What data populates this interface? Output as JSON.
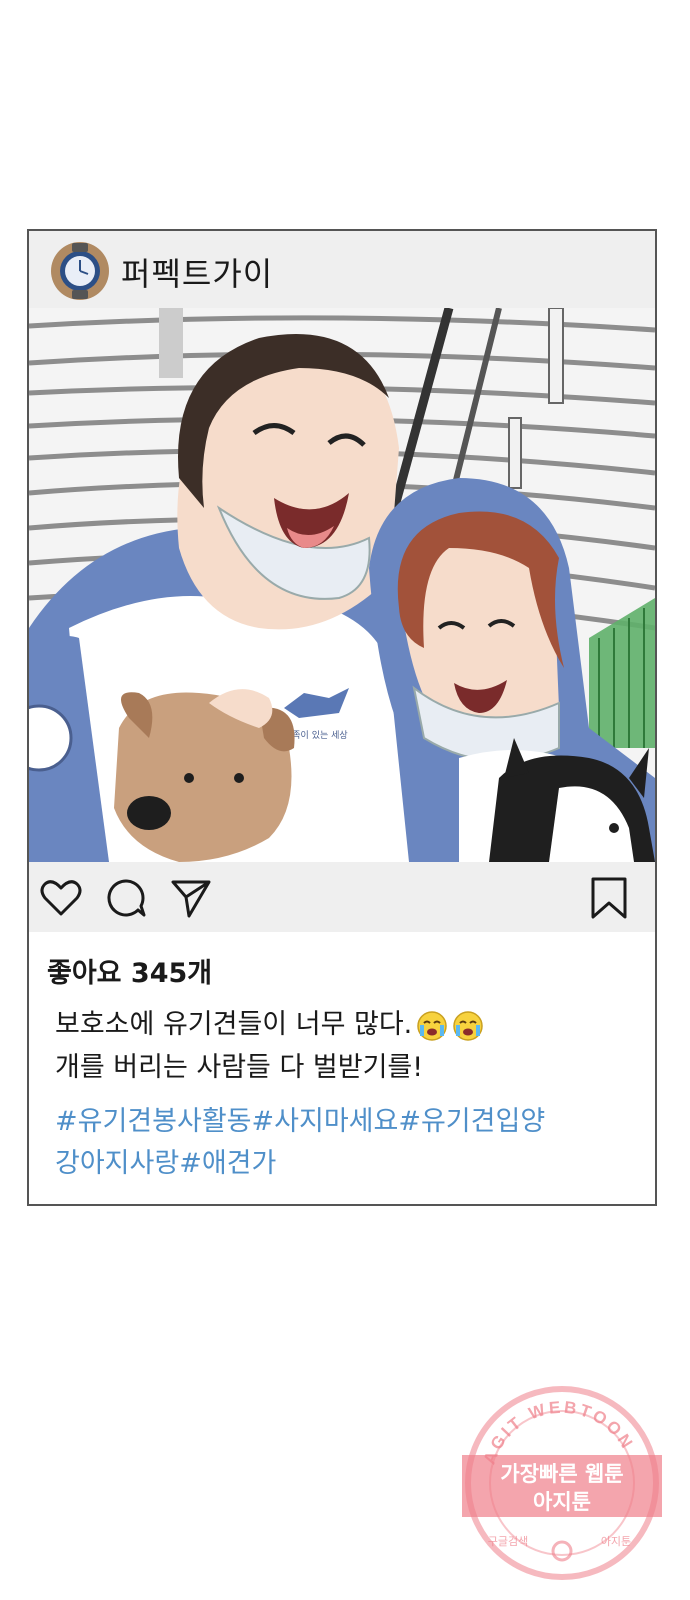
{
  "post": {
    "username": "퍼펙트가이",
    "likes_text": "좋아요 345개",
    "caption_line1": "보호소에 유기견들이 너무 많다.",
    "caption_line2": "개를 버리는 사람들 다 벌받기를!",
    "caption_emojis": [
      "crying-face-icon",
      "crying-face-icon"
    ],
    "hashtags": [
      "#유기견봉사활동",
      "#사지마세요",
      "#유기견입양",
      "강아지사랑",
      "#애견가"
    ]
  },
  "photo": {
    "vest_text_left": "가족이 있는 세상",
    "vest_text_right": "가족이 있는 세상"
  },
  "watermark": {
    "ring_text": "AGIT WEBTOON",
    "line1": "가장빠른 웹툰",
    "line2": "아지툰",
    "bottom_left": "구글검색",
    "bottom_right": "아지툰"
  },
  "colors": {
    "hashtag": "#4f8fc9",
    "header_bg": "#efefef",
    "hoodie_blue": "#6a86c0",
    "stamp_red": "#ef7f8a"
  }
}
